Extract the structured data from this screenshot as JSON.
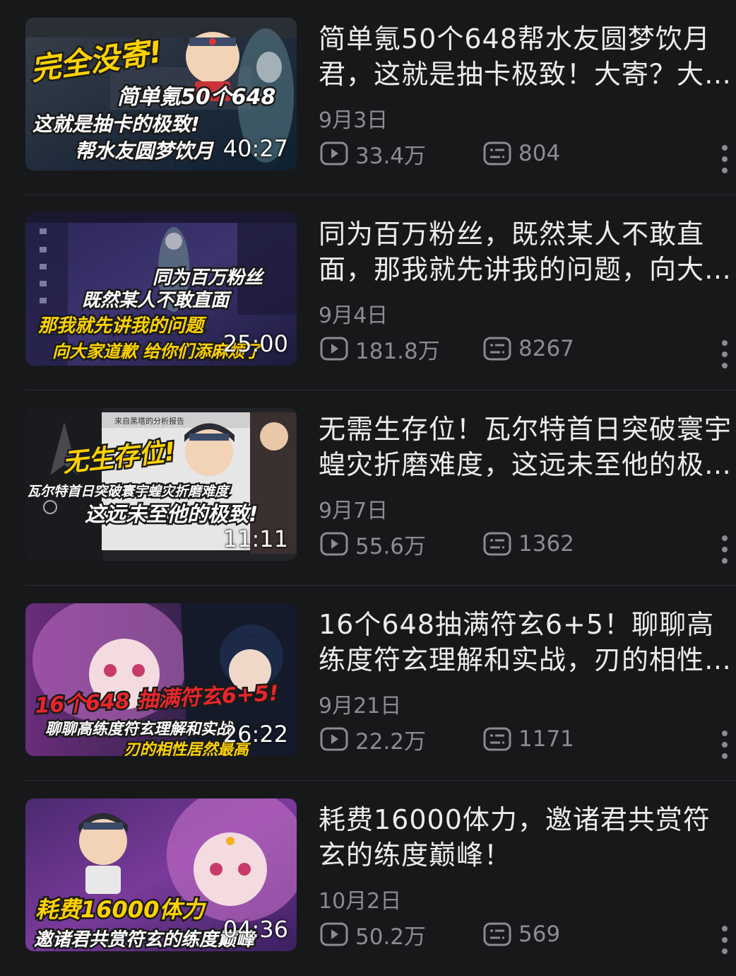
{
  "videos": [
    {
      "title": "简单氪50个648帮水友圆梦饮月君，这就是抽卡极致！大寄？大赚！",
      "date": "9月3日",
      "views": "33.4万",
      "comments": "804",
      "duration": "40:27",
      "thumb_text": [
        "完全没寄!",
        "简单氪50个648",
        "这就是抽卡的极致!",
        "帮水友圆梦饮月"
      ]
    },
    {
      "title": "同为百万粉丝，既然某人不敢直面，那我就先讲我的问题，向大家道歉",
      "date": "9月4日",
      "views": "181.8万",
      "comments": "8267",
      "duration": "25:00",
      "thumb_text": [
        "同为百万粉丝",
        "既然某人不敢直面",
        "那我就先讲我的问题",
        "向大家道歉 给你们添麻烦了"
      ]
    },
    {
      "title": "无需生存位！瓦尔特首日突破寰宇蝗灾折磨难度，这远未至他的极致！",
      "date": "9月7日",
      "views": "55.6万",
      "comments": "1362",
      "duration": "11:11",
      "thumb_text": [
        "无生存位!",
        "瓦尔特首日突破寰宇蝗灾折磨难度",
        "这远未至他的极致!",
        "来自黑塔的分析报告"
      ]
    },
    {
      "title": "16个648抽满符玄6+5！聊聊高练度符玄理解和实战，刃的相性居然最高",
      "date": "9月21日",
      "views": "22.2万",
      "comments": "1171",
      "duration": "26:22",
      "thumb_text": [
        "16个648 抽满符玄6+5!",
        "聊聊高练度符玄理解和实战",
        "刃的相性居然最高"
      ]
    },
    {
      "title": "耗费16000体力，邀诸君共赏符玄的练度巅峰！",
      "date": "10月2日",
      "views": "50.2万",
      "comments": "569",
      "duration": "04:36",
      "thumb_text": [
        "耗费16000体力",
        "邀诸君共赏符玄的练度巅峰"
      ]
    }
  ],
  "icons": {
    "views": "play-count-icon",
    "comments": "danmaku-icon",
    "more": "more-vertical-icon"
  },
  "colors": {
    "background": "#17181a",
    "title": "#ececec",
    "meta": "#8b8c8f",
    "caption_yellow": "#ffd200",
    "caption_red": "#e8262a"
  }
}
